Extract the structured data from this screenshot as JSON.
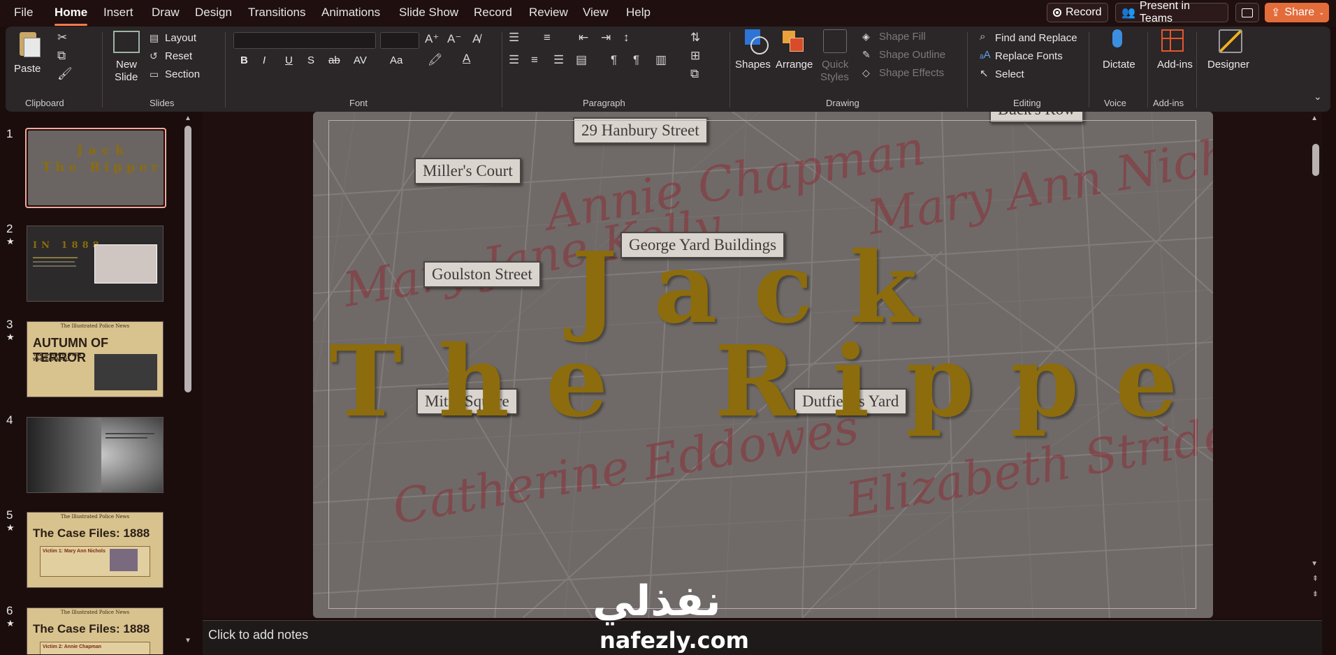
{
  "menu": {
    "tabs": [
      "File",
      "Home",
      "Insert",
      "Draw",
      "Design",
      "Transitions",
      "Animations",
      "Slide Show",
      "Record",
      "Review",
      "View",
      "Help"
    ],
    "active_tab": "Home",
    "record_label": "Record",
    "present_label": "Present in Teams",
    "share_label": "Share"
  },
  "ribbon": {
    "clipboard": {
      "paste": "Paste",
      "label": "Clipboard"
    },
    "slides": {
      "new_slide_1": "New",
      "new_slide_2": "Slide",
      "layout": "Layout",
      "reset": "Reset",
      "section": "Section",
      "label": "Slides"
    },
    "font": {
      "label": "Font",
      "bold": "B",
      "italic": "I",
      "underline": "U",
      "strike": "S",
      "strike2": "ab",
      "spacing": "AV",
      "case": "Aa"
    },
    "paragraph": {
      "label": "Paragraph"
    },
    "drawing": {
      "shapes": "Shapes",
      "arrange": "Arrange",
      "quick_1": "Quick",
      "quick_2": "Styles",
      "fill": "Shape Fill",
      "outline": "Shape Outline",
      "effects": "Shape Effects",
      "label": "Drawing"
    },
    "editing": {
      "find_replace": "Find and Replace",
      "replace_fonts": "Replace Fonts",
      "select": "Select",
      "label": "Editing"
    },
    "voice": {
      "dictate": "Dictate",
      "label": "Voice"
    },
    "addins": {
      "addins": "Add-ins",
      "label": "Add-ins"
    },
    "designer": {
      "label": "Designer"
    }
  },
  "thumbnails": [
    {
      "num": "1",
      "star": "",
      "title_1": "Jack",
      "title_2": "The Ripper"
    },
    {
      "num": "2",
      "star": "★",
      "title_1": "IN 1888"
    },
    {
      "num": "3",
      "star": "★",
      "masthead": "The Illustrated Police News",
      "title_1": "AUTUMN OF TERROR",
      "subtitle": "THE SHADOW OVER WHITECHAPEL"
    },
    {
      "num": "4",
      "star": ""
    },
    {
      "num": "5",
      "star": "★",
      "masthead": "The Illustrated Police News",
      "title_1": "The Case Files: 1888",
      "subtitle": "Victim 1: Mary Ann Nichols"
    },
    {
      "num": "6",
      "star": "★",
      "masthead": "The Illustrated Police News",
      "title_1": "The Case Files: 1888",
      "subtitle": "Victim 2: Annie Chapman"
    }
  ],
  "slide": {
    "title_line1": "Jack",
    "title_line2": "The Ripper",
    "streets": [
      "29 Hanbury Street",
      "Miller's Court",
      "George Yard Buildings",
      "Goulston Street",
      "Mitre Square",
      "Dutfield's Yard",
      "Buck's Row"
    ],
    "names": [
      "Annie Chapman",
      "Mary Ann Nichols",
      "Mary Jane Kelly",
      "Catherine Eddowes",
      "Elizabeth Stride"
    ],
    "title_color": "#8c6c0c"
  },
  "notes": {
    "placeholder": "Click to add notes"
  },
  "watermark": {
    "arabic": "نفذلي",
    "latin": "nafezly.com"
  }
}
